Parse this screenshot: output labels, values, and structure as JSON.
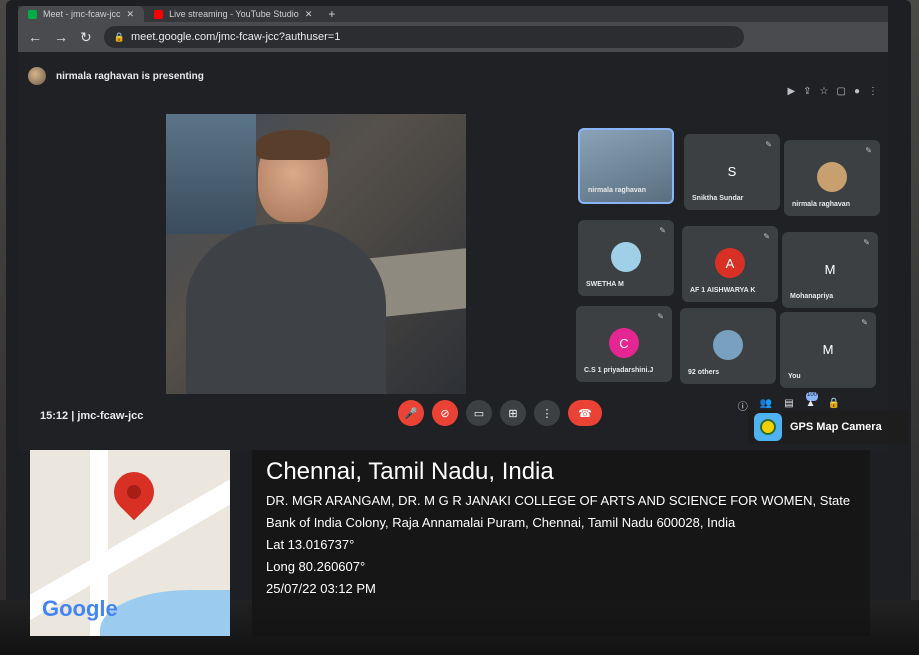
{
  "browser": {
    "tabs": [
      {
        "label": "Meet - jmc-fcaw-jcc",
        "active": true
      },
      {
        "label": "Live streaming - YouTube Studio",
        "active": false
      }
    ],
    "url": "meet.google.com/jmc-fcaw-jcc?authuser=1"
  },
  "meet": {
    "presenting_label": "nirmala raghavan is presenting",
    "time": "15:12",
    "separator": "|",
    "meeting_code": "jmc-fcaw-jcc",
    "participants_badge": "100",
    "tiles": [
      {
        "name": "nirmala raghavan",
        "initial": "",
        "color": ""
      },
      {
        "name": "Sniktha Sundar",
        "initial": "S",
        "color": "#3c4043"
      },
      {
        "name": "nirmala raghavan",
        "initial": "",
        "color": ""
      },
      {
        "name": "SWETHA M",
        "initial": "",
        "color": ""
      },
      {
        "name": "AF 1 AISHWARYA K",
        "initial": "A",
        "color": "#d93025"
      },
      {
        "name": "Mohanapriya",
        "initial": "M",
        "color": "#3c4043"
      },
      {
        "name": "C.S 1 priyadarshini.J",
        "initial": "C",
        "color": "#e52592"
      },
      {
        "name": "92 others",
        "initial": "",
        "color": ""
      },
      {
        "name": "You",
        "initial": "M",
        "color": "#3c4043"
      }
    ]
  },
  "gps": {
    "app_name": "GPS Map Camera",
    "city": "Chennai, Tamil Nadu, India",
    "address": "DR. MGR ARANGAM, DR. M G R JANAKI COLLEGE OF ARTS AND SCIENCE FOR WOMEN, State Bank of India Colony, Raja Annamalai Puram, Chennai, Tamil Nadu 600028, India",
    "lat": "Lat 13.016737°",
    "long": "Long 80.260607°",
    "datetime": "25/07/22 03:12 PM",
    "map_logo": "Google"
  }
}
